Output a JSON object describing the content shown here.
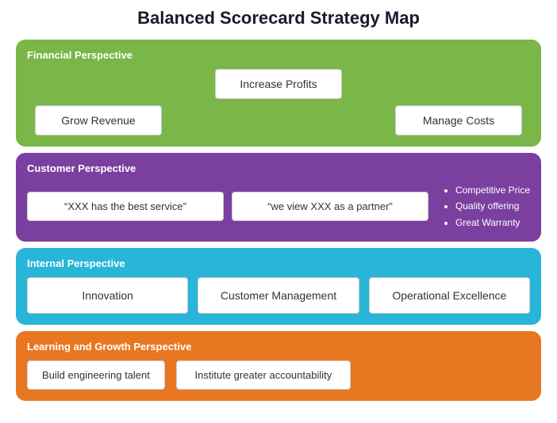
{
  "title": "Balanced Scorecard Strategy Map",
  "financial": {
    "label": "Financial Perspective",
    "top_box": "Increase Profits",
    "bottom_left": "Grow Revenue",
    "bottom_right": "Manage Costs"
  },
  "customer": {
    "label": "Customer Perspective",
    "box1": "“XXX has the best service”",
    "box2": "“we view XXX as a partner”",
    "bullets": [
      "Competitive Price",
      "Quality offering",
      "Great Warranty"
    ]
  },
  "internal": {
    "label": "Internal Perspective",
    "box1": "Innovation",
    "box2": "Customer Management",
    "box3": "Operational Excellence"
  },
  "learning": {
    "label": "Learning and Growth Perspective",
    "box1": "Build engineering talent",
    "box2": "Institute greater accountability"
  }
}
